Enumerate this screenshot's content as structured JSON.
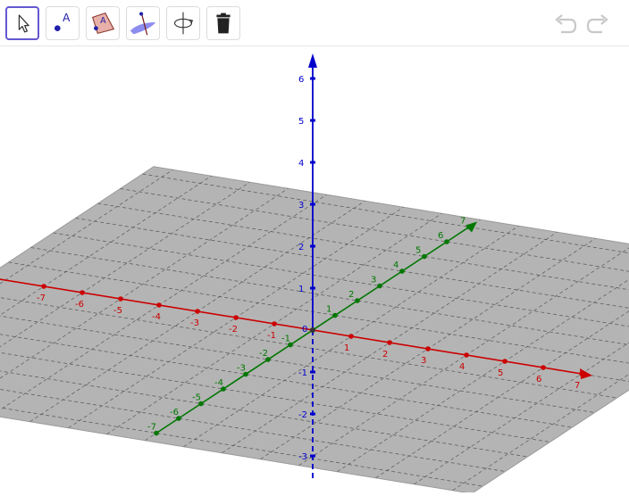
{
  "toolbar": {
    "tools": [
      {
        "name": "Move",
        "icon": "arrow-pointer-icon",
        "selected": true
      },
      {
        "name": "Point",
        "icon": "point-icon",
        "label": "A"
      },
      {
        "name": "Polygon",
        "icon": "polygon-icon",
        "label": "A"
      },
      {
        "name": "Plane",
        "icon": "plane-icon"
      },
      {
        "name": "Rotate View",
        "icon": "rotate-view-icon"
      },
      {
        "name": "Delete",
        "icon": "trash-icon"
      }
    ],
    "undo_icon": "undo-icon",
    "redo_icon": "redo-icon"
  },
  "axes": {
    "x": {
      "color": "#cc0000",
      "ticks": [
        "-7",
        "-6",
        "-5",
        "-4",
        "-3",
        "-2",
        "-1",
        "1",
        "2",
        "3",
        "4",
        "5",
        "6",
        "7"
      ]
    },
    "y": {
      "color": "#007700",
      "ticks": [
        "-7",
        "-6",
        "-5",
        "-4",
        "-3",
        "-2",
        "-1",
        "1",
        "2",
        "3",
        "4",
        "5",
        "6",
        "7"
      ]
    },
    "z": {
      "color": "#0000cc",
      "ticks": [
        "-3",
        "-2",
        "-1",
        "1",
        "2",
        "3",
        "4",
        "5",
        "6"
      ]
    },
    "origin_label": "0"
  },
  "colors": {
    "plane": "#b4b4b4",
    "accent": "#6557d2"
  }
}
